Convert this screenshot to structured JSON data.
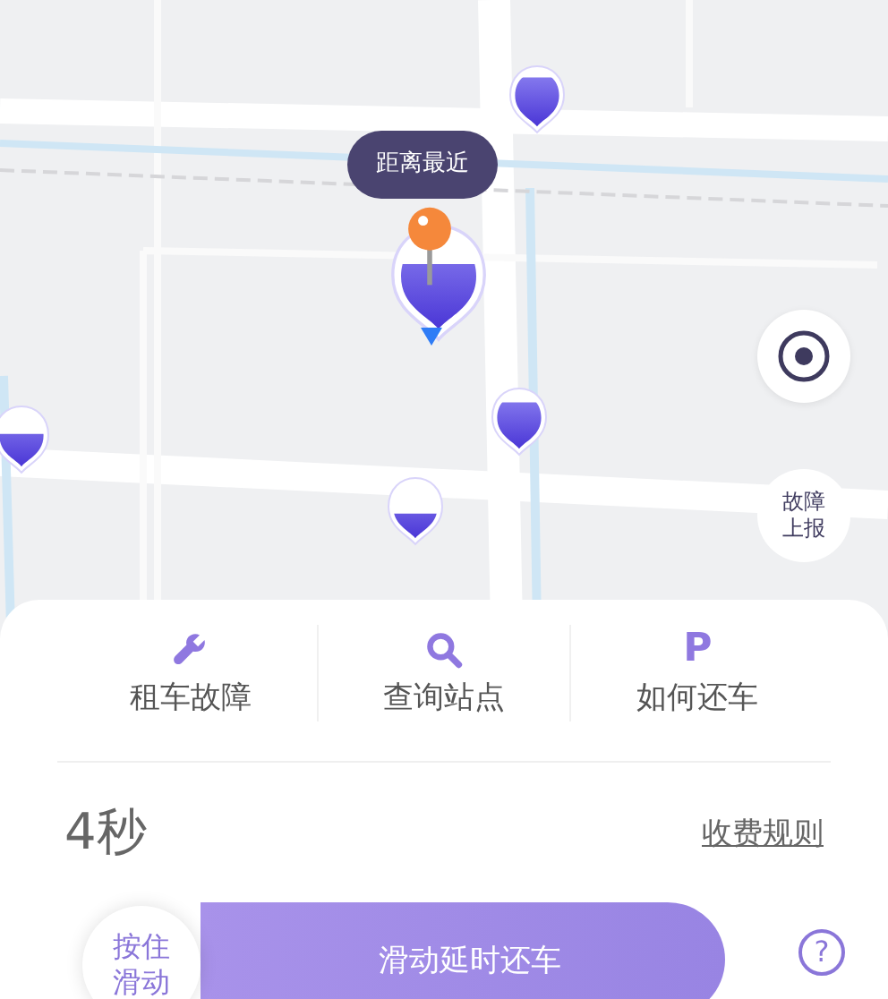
{
  "stations": [
    {
      "selected": false
    },
    {
      "selected": true
    },
    {
      "selected": false
    },
    {
      "selected": false
    },
    {
      "selected": false
    }
  ],
  "nearest_tooltip": "距离最近",
  "report_button": "故障上报",
  "actions": [
    {
      "kind": "wrench",
      "label": "租车故障"
    },
    {
      "kind": "search",
      "label": "查询站点"
    },
    {
      "kind": "letter",
      "glyph": "P",
      "label": "如何还车"
    }
  ],
  "timer": "4秒",
  "fee_link": "收费规则",
  "slider": {
    "thumb": "按住滑动",
    "label": "滑动延时还车"
  },
  "help": "?"
}
